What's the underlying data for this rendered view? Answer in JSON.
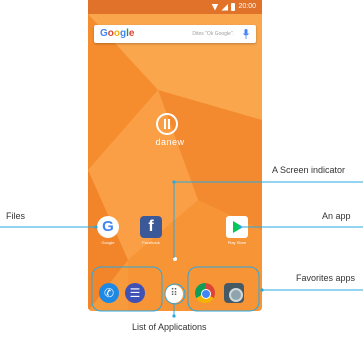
{
  "status_bar": {
    "time": "20:00"
  },
  "search": {
    "logo_text": "Google",
    "hint": "Dites \"Ok Google\"."
  },
  "wallpaper": {
    "logo_text": "danew"
  },
  "home_apps": [
    {
      "label": "Google",
      "icon": "google-icon"
    },
    {
      "label": "Facebook",
      "icon": "facebook-icon"
    },
    {
      "label": "Play Store",
      "icon": "play-store-icon"
    }
  ],
  "dock": [
    {
      "icon": "phone-icon"
    },
    {
      "icon": "messages-icon"
    },
    {
      "icon": "apps-grid-icon"
    },
    {
      "icon": "chrome-icon"
    },
    {
      "icon": "camera-icon"
    }
  ],
  "callouts": {
    "screen_indicator": "A  Screen indicator",
    "files": "Files",
    "an_app": "An app",
    "favorites_apps": "Favorites apps",
    "list_of_applications": "List of Applications"
  },
  "colors": {
    "callout_line": "#29a8e0",
    "wallpaper": "#f79a3c",
    "status_bar": "#e0722a"
  }
}
